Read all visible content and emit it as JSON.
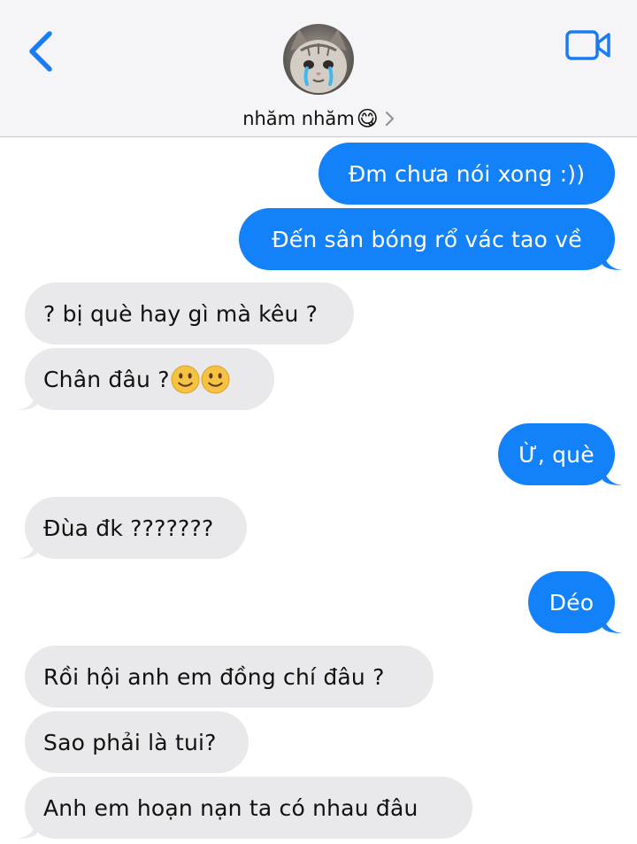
{
  "header": {
    "contact_name": "nhăm nhăm",
    "contact_emoji": "😋"
  },
  "messages": [
    {
      "direction": "outgoing",
      "text": "Đm chưa nói xong :))"
    },
    {
      "direction": "outgoing",
      "text": "Đến sân bóng rổ vác tao về"
    },
    {
      "direction": "incoming",
      "text": "? bị què hay gì mà kêu ?"
    },
    {
      "direction": "incoming",
      "text": "Chân đâu ?",
      "trailing_emoji": [
        "slightly-smiling-face",
        "slightly-smiling-face"
      ]
    },
    {
      "direction": "outgoing",
      "text": "Ừ, què"
    },
    {
      "direction": "incoming",
      "text": "Đùa đk ???????"
    },
    {
      "direction": "outgoing",
      "text": "Déo"
    },
    {
      "direction": "incoming",
      "text": "Rồi hội anh em đồng chí đâu ?"
    },
    {
      "direction": "incoming",
      "text": "Sao phải là tui?"
    },
    {
      "direction": "incoming",
      "text": "Anh em hoạn nạn ta có nhau đâu"
    }
  ],
  "colors": {
    "outgoing_bubble": "#1381fa",
    "incoming_bubble": "#e9e9eb",
    "accent": "#1a7cf5",
    "header_bg": "#f5f5f7"
  }
}
